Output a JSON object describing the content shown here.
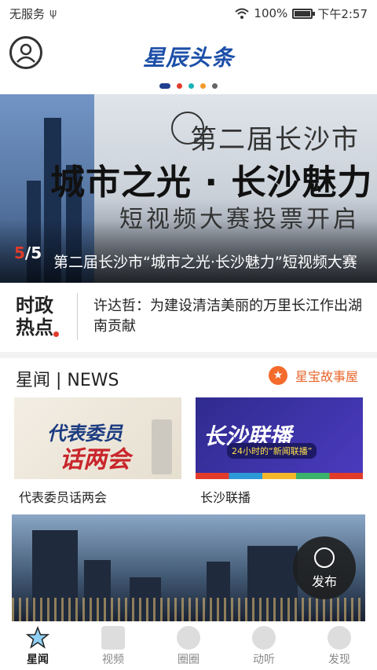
{
  "status_bar": {
    "carrier": "无服务",
    "battery": "100%",
    "battery_level": 1.0,
    "time": "下午2:57"
  },
  "header": {
    "logo_text": "星辰头条"
  },
  "banner": {
    "dot_colors": [
      "#1f3f8f",
      "#e23b2a",
      "#19b3b8",
      "#f29a2a",
      "#666666"
    ],
    "active_dot": 0,
    "headline_line1": "第二届长沙市",
    "headline_line2": "城市之光 · 长沙魅力",
    "headline_line3": "短视频大赛投票开启",
    "current_index": "5",
    "total": "/5",
    "caption": "第二届长沙市“城市之光·长沙魅力”短视频大赛"
  },
  "hot_news": {
    "badge": "时政热点",
    "text": "许达哲：为建设清洁美丽的万里长江作出湖南贡献"
  },
  "section": {
    "title": "星闻 | NEWS",
    "link_label": "星宝故事屋",
    "cards": [
      {
        "img_line1": "代表委员",
        "img_line2": "话两会",
        "label": "代表委员话两会"
      },
      {
        "img_line1": "长沙联播",
        "img_line2": "24小时的“新闻联播”",
        "label": "长沙联播"
      }
    ]
  },
  "fab": {
    "label": "发布",
    "icon": "headset-icon"
  },
  "tabbar": {
    "items": [
      {
        "label": "星闻",
        "icon": "star-icon",
        "active": true
      },
      {
        "label": "视频",
        "icon": "video-icon",
        "active": false
      },
      {
        "label": "圈圈",
        "icon": "circle-icon",
        "active": false
      },
      {
        "label": "动听",
        "icon": "headphones-icon",
        "active": false
      },
      {
        "label": "发现",
        "icon": "discover-icon",
        "active": false
      }
    ]
  }
}
